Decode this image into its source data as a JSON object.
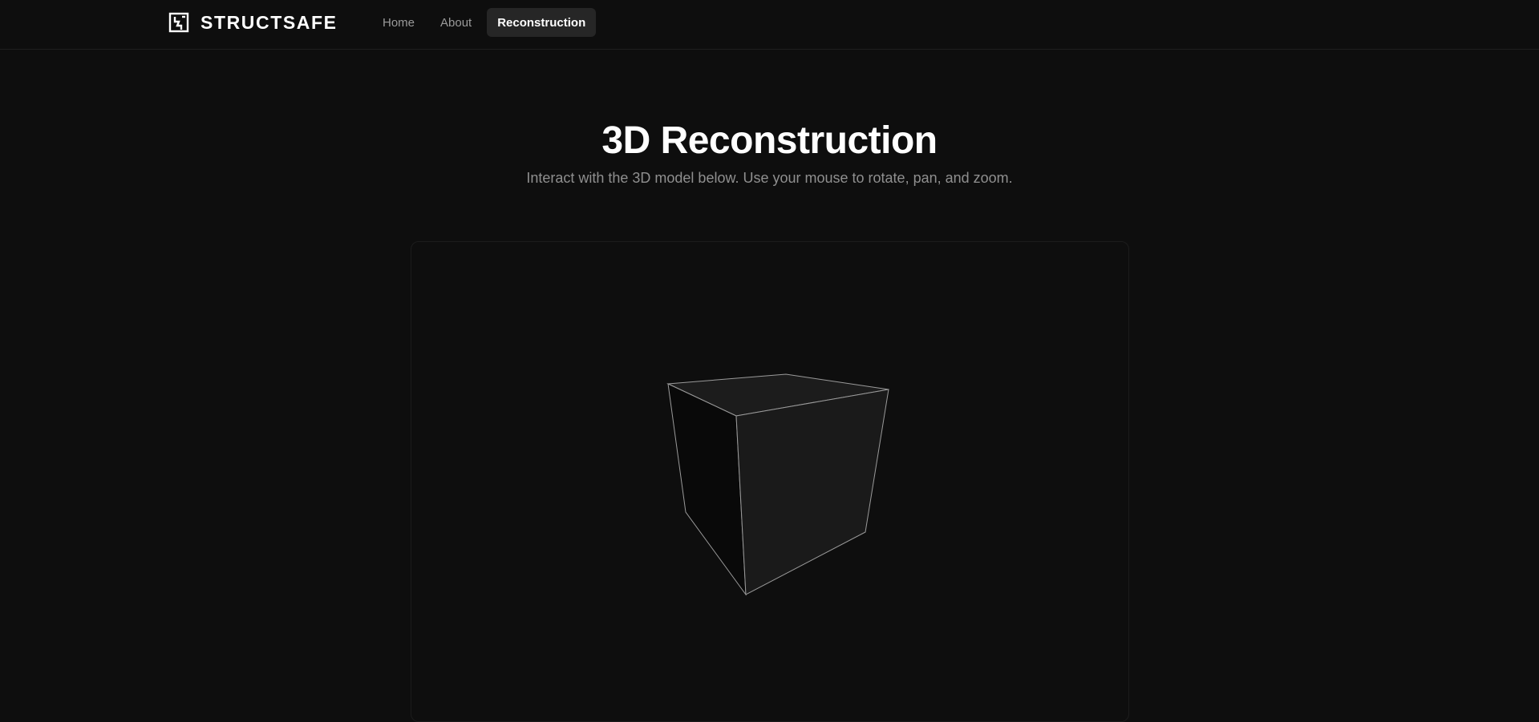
{
  "header": {
    "brand_name": "STRUCTSAFE",
    "logo_icon": "building-crack-icon",
    "nav": [
      {
        "label": "Home",
        "active": false
      },
      {
        "label": "About",
        "active": false
      },
      {
        "label": "Reconstruction",
        "active": true
      }
    ]
  },
  "main": {
    "title": "3D Reconstruction",
    "subtitle": "Interact with the 3D model below. Use your mouse to rotate, pan, and zoom."
  },
  "viewer": {
    "model": "cube-wireframe",
    "colors": {
      "background": "#0e0e0e",
      "edge": "#9a9a9a",
      "face_front": "#1a1a1a",
      "face_left": "#090909",
      "face_top": "#1c1c1c"
    }
  }
}
